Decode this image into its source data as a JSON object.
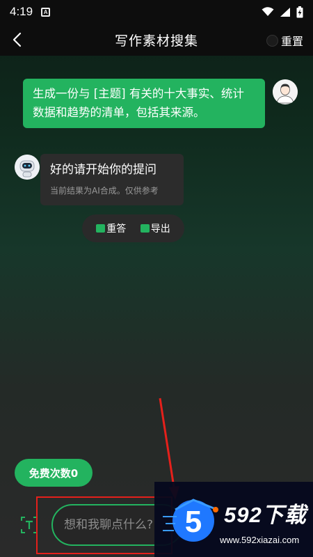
{
  "status_bar": {
    "time": "4:19",
    "a_icon_letter": "A"
  },
  "header": {
    "title": "写作素材搜集",
    "reset_label": "重置"
  },
  "messages": {
    "user_text": "生成一份与 [主题] 有关的十大事实、统计数据和趋势的清单，包括其来源。",
    "bot_text": "好的请开始你的提问",
    "bot_note": "当前结果为AI合成。仅供参考"
  },
  "actions": {
    "retry_label": "重答",
    "export_label": "导出"
  },
  "free_count": {
    "label": "免费次数0"
  },
  "input": {
    "placeholder": "想和我聊点什么?"
  },
  "watermark": {
    "title": "592下载",
    "url": "www.592xiazai.com",
    "logo_digit": "5"
  },
  "colors": {
    "accent": "#23b35f",
    "annotation": "#e5201b",
    "header_bg": "#0d0d0d"
  }
}
